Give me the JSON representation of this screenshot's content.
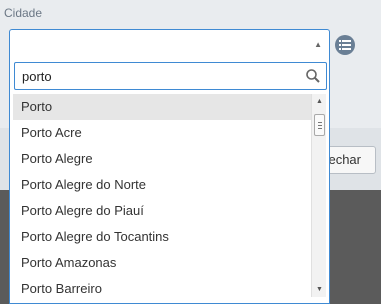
{
  "form": {
    "city_label": "Cidade",
    "selected_value": ""
  },
  "dropdown": {
    "search_value": "porto",
    "options": [
      "Porto",
      "Porto Acre",
      "Porto Alegre",
      "Porto Alegre do Norte",
      "Porto Alegre do Piauí",
      "Porto Alegre do Tocantins",
      "Porto Amazonas",
      "Porto Barreiro"
    ],
    "highlighted_index": 0
  },
  "footer": {
    "close_label": "echar"
  },
  "icons": {
    "list": "list-icon",
    "search": "search-icon",
    "caret": "caret-up-icon"
  },
  "colors": {
    "focus_border": "#3f8ad3",
    "highlight": "#e6e6e6",
    "list_button": "#6a7f95"
  }
}
